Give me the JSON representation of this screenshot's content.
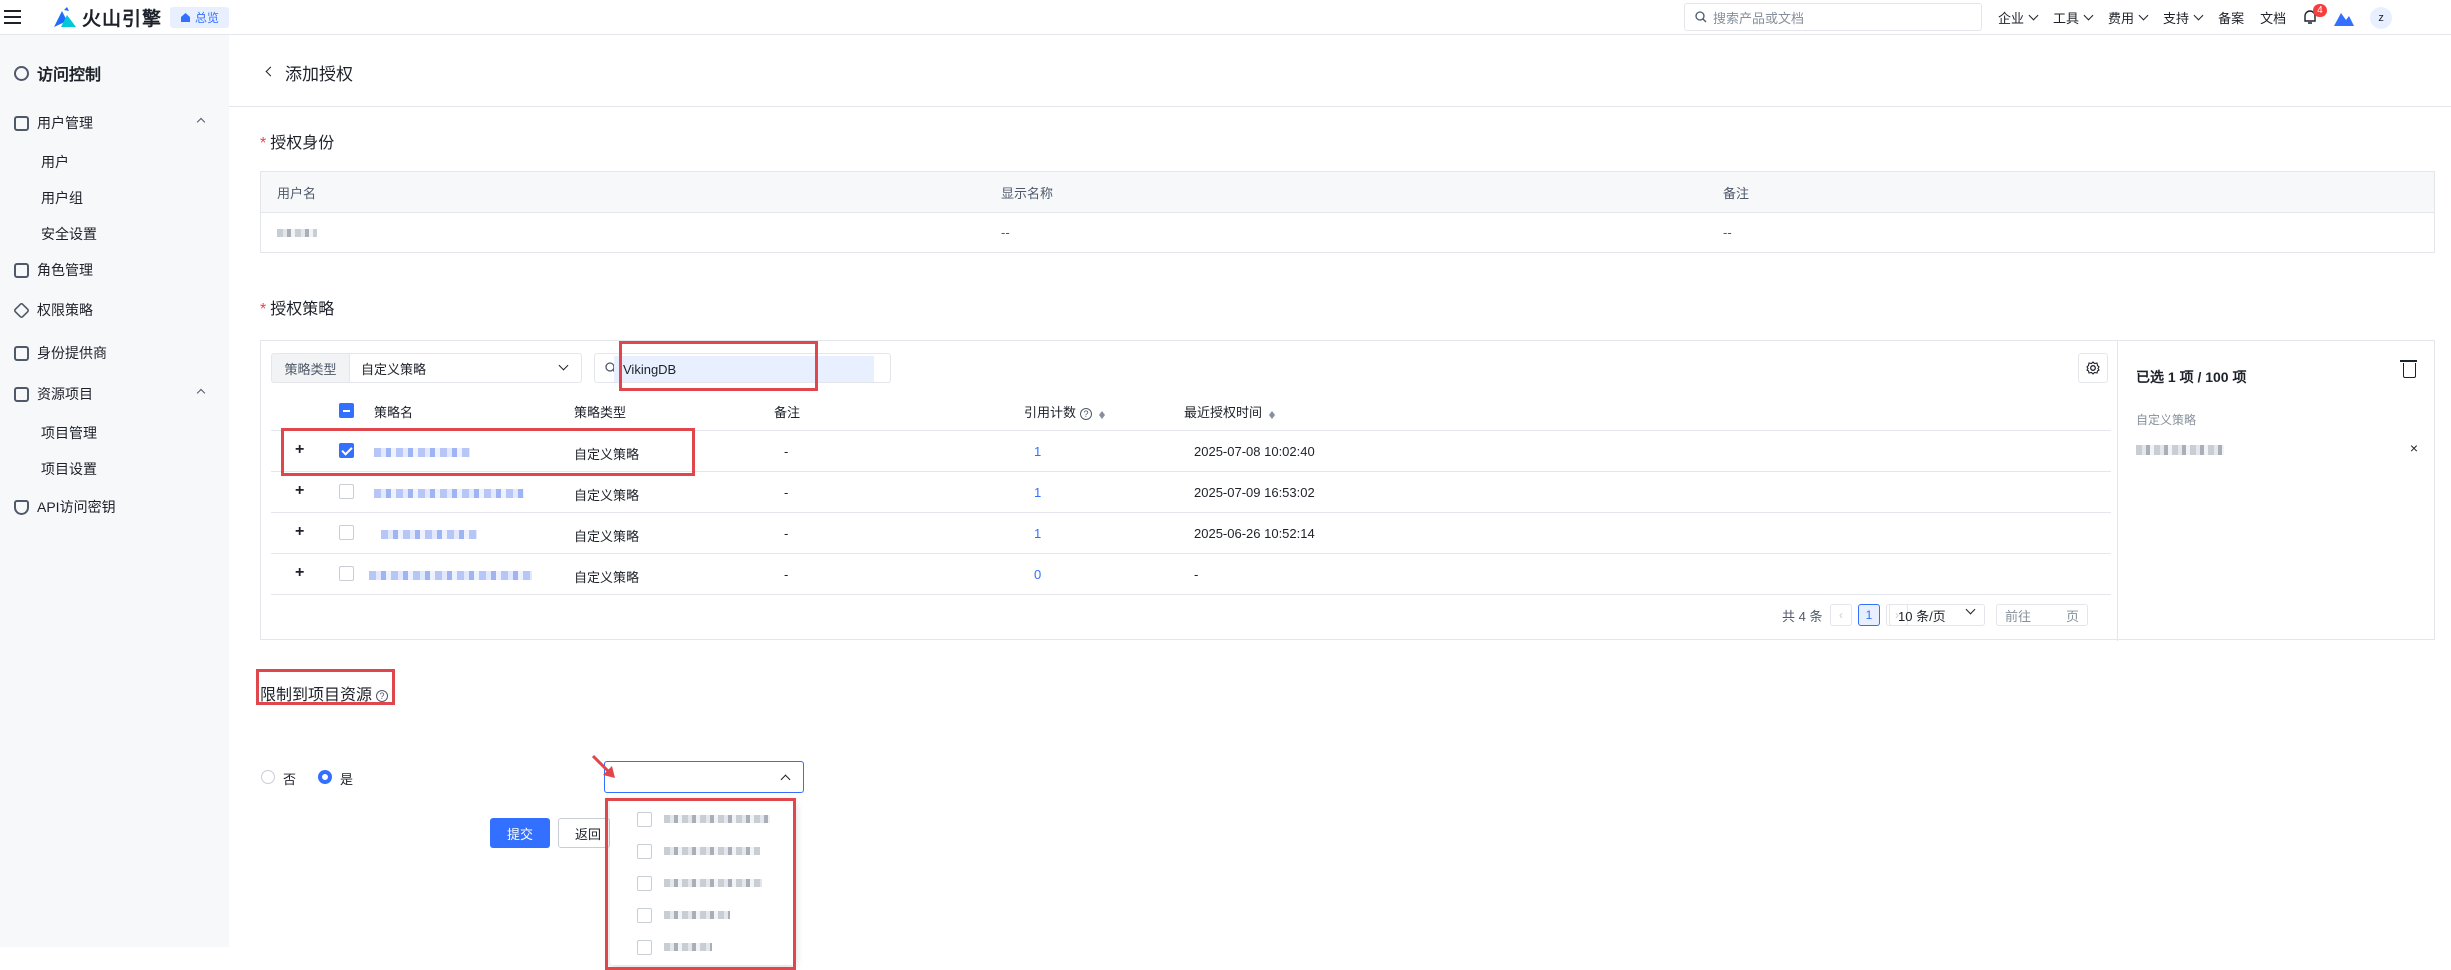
{
  "topbar": {
    "brand": "火山引擎",
    "home_tag": "总览",
    "search_placeholder": "搜索产品或文档",
    "nav": [
      "企业",
      "工具",
      "费用",
      "支持"
    ],
    "links": [
      "备案",
      "文档"
    ],
    "notification_count": "4",
    "avatar": "z"
  },
  "sidebar": {
    "title": "访问控制",
    "user_mgmt": "用户管理",
    "user": "用户",
    "user_group": "用户组",
    "security": "安全设置",
    "role_mgmt": "角色管理",
    "policy": "权限策略",
    "idp": "身份提供商",
    "resources": "资源项目",
    "project_mgmt": "项目管理",
    "project_settings": "项目设置",
    "api_keys": "API访问密钥"
  },
  "page": {
    "title": "添加授权",
    "identity_section": "授权身份",
    "identity_cols": [
      "用户名",
      "显示名称",
      "备注"
    ],
    "identity_display": "--",
    "identity_remark": "--",
    "policy_section": "授权策略",
    "policy_type_label": "策略类型",
    "policy_type_value": "自定义策略",
    "search_value": "VikingDB",
    "table_cols": {
      "name": "策略名",
      "type": "策略类型",
      "remark": "备注",
      "count": "引用计数",
      "time": "最近授权时间"
    },
    "rows": [
      {
        "type": "自定义策略",
        "remark": "-",
        "count": "1",
        "time": "2025-07-08 10:02:40"
      },
      {
        "type": "自定义策略",
        "remark": "-",
        "count": "1",
        "time": "2025-07-09 16:53:02"
      },
      {
        "type": "自定义策略",
        "remark": "-",
        "count": "1",
        "time": "2025-06-26 10:52:14"
      },
      {
        "type": "自定义策略",
        "remark": "-",
        "count": "0",
        "time": "-"
      }
    ],
    "pager": {
      "total": "共 4 条",
      "current": "1",
      "page_size": "10 条/页",
      "goto": "前往",
      "page_unit": "页"
    },
    "selected": {
      "summary": "已选 1 项 / 100 项",
      "category": "自定义策略",
      "remove": "×"
    },
    "restrict": {
      "title": "限制到项目资源",
      "no": "否",
      "yes": "是"
    },
    "submit": "提交",
    "back": "返回"
  }
}
